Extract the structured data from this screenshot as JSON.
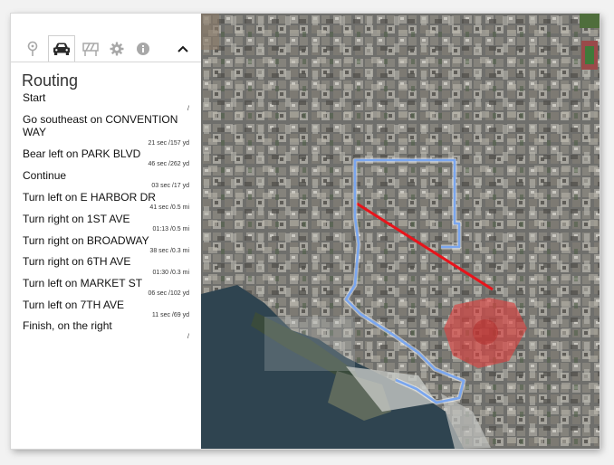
{
  "toolbar": {
    "buttons": [
      {
        "name": "location-pin-icon"
      },
      {
        "name": "car-icon",
        "active": true
      },
      {
        "name": "barrier-icon"
      },
      {
        "name": "gear-icon"
      },
      {
        "name": "info-icon"
      },
      {
        "name": "chevron-up-icon"
      }
    ]
  },
  "panel": {
    "title": "Routing",
    "steps": [
      {
        "text": "Start",
        "meta": "/"
      },
      {
        "text": "Go southeast on CONVENTION WAY",
        "meta": "21 sec /157 yd"
      },
      {
        "text": "Bear left on PARK BLVD",
        "meta": "46 sec /262 yd"
      },
      {
        "text": "Continue",
        "meta": "03 sec /17 yd"
      },
      {
        "text": "Turn left on E HARBOR DR",
        "meta": "41 sec /0.5 mi"
      },
      {
        "text": "Turn right on 1ST AVE",
        "meta": "01:13 /0.5 mi"
      },
      {
        "text": "Turn right on BROADWAY",
        "meta": "38 sec /0.3 mi"
      },
      {
        "text": "Turn right on 6TH AVE",
        "meta": "01:30 /0.3 mi"
      },
      {
        "text": "Turn left on MARKET ST",
        "meta": "06 sec /102 yd"
      },
      {
        "text": "Turn left on 7TH AVE",
        "meta": "11 sec /69 yd"
      },
      {
        "text": "Finish, on the right",
        "meta": "/"
      }
    ]
  },
  "map": {
    "route_color": "#7aa6ee",
    "barrier_line_color": "#e8141b",
    "barrier_polygon_color": "#e0413f",
    "water_color": "#2f4450"
  }
}
